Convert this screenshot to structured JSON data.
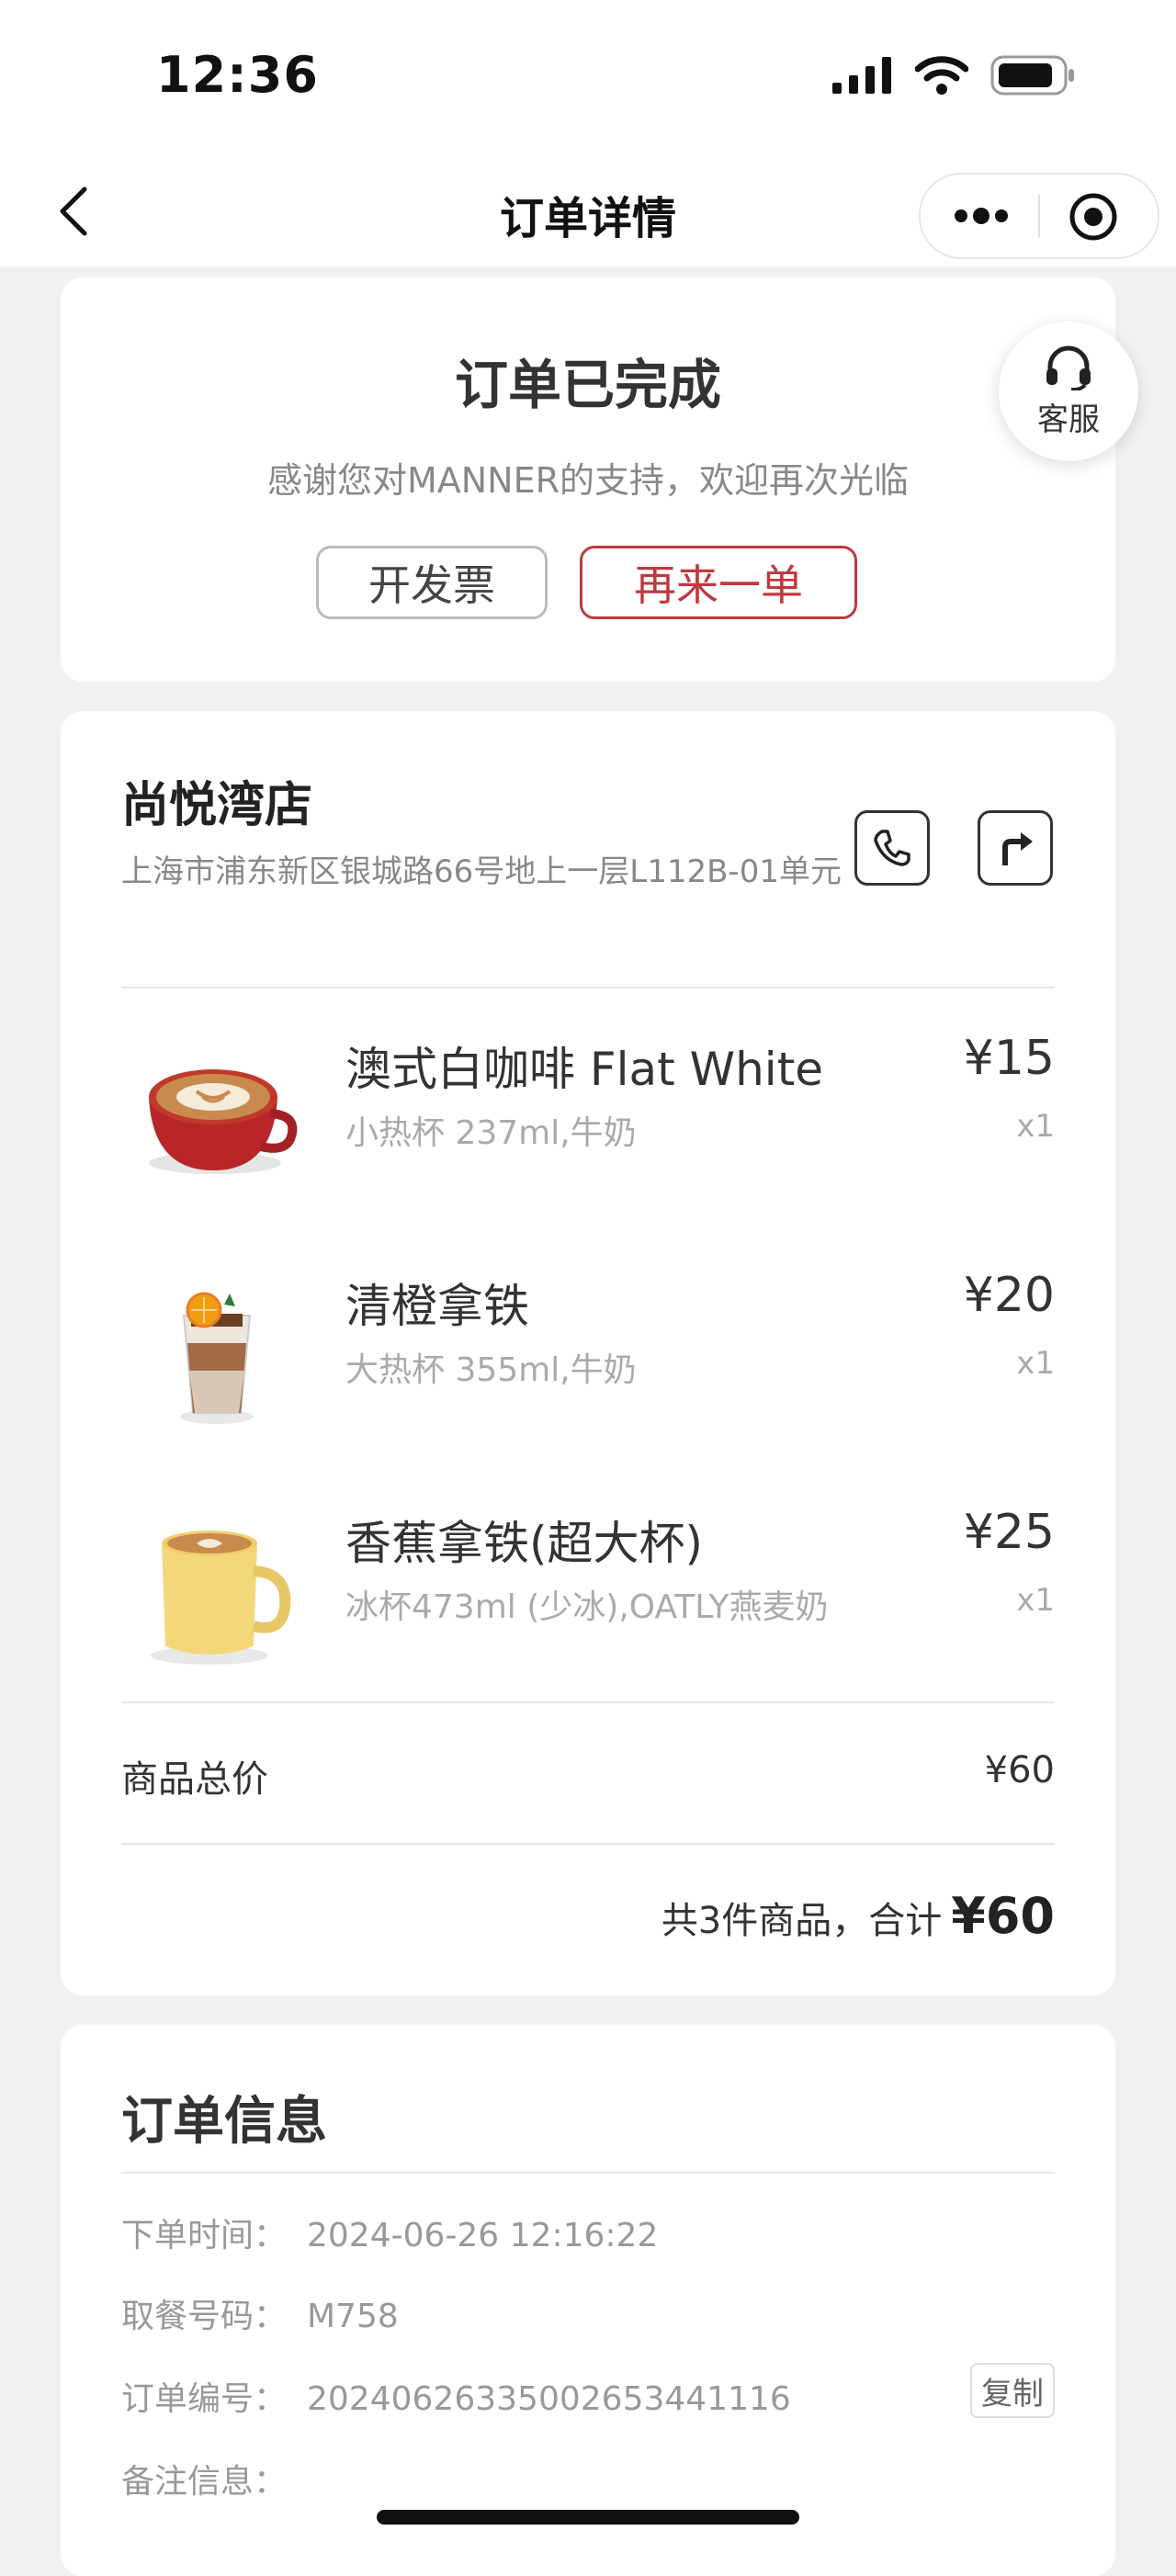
{
  "status_bar": {
    "time": "12:36"
  },
  "nav": {
    "title": "订单详情"
  },
  "order_status": {
    "title": "订单已完成",
    "subtitle": "感谢您对MANNER的支持，欢迎再次光临",
    "invoice_label": "开发票",
    "reorder_label": "再来一单",
    "accent_color": "#c0383e"
  },
  "service": {
    "label": "客服"
  },
  "store": {
    "name": "尚悦湾店",
    "address": "上海市浦东新区银城路66号地上一层L112B-01单元"
  },
  "items": [
    {
      "name": "澳式白咖啡 Flat White",
      "spec": "小热杯 237ml,牛奶",
      "price": "¥15",
      "qty": "x1",
      "image": "flat-white-red-cup"
    },
    {
      "name": "清橙拿铁",
      "spec": "大热杯 355ml,牛奶",
      "price": "¥20",
      "qty": "x1",
      "image": "orange-latte-glass"
    },
    {
      "name": "香蕉拿铁(超大杯)",
      "spec": "冰杯473ml (少冰),OATLY燕麦奶",
      "price": "¥25",
      "qty": "x1",
      "image": "banana-latte-yellow-mug"
    }
  ],
  "totals": {
    "goods_total_label": "商品总价",
    "goods_total_value": "¥60",
    "summary_text": "共3件商品，合计",
    "summary_amount": "¥60"
  },
  "order_info": {
    "title": "订单信息",
    "rows": [
      {
        "label": "下单时间：",
        "value": "2024-06-26 12:16:22"
      },
      {
        "label": "取餐号码：",
        "value": "M758"
      },
      {
        "label": "订单编号：",
        "value": "20240626335002653441116"
      },
      {
        "label": "备注信息：",
        "value": ""
      }
    ],
    "copy_label": "复制"
  }
}
